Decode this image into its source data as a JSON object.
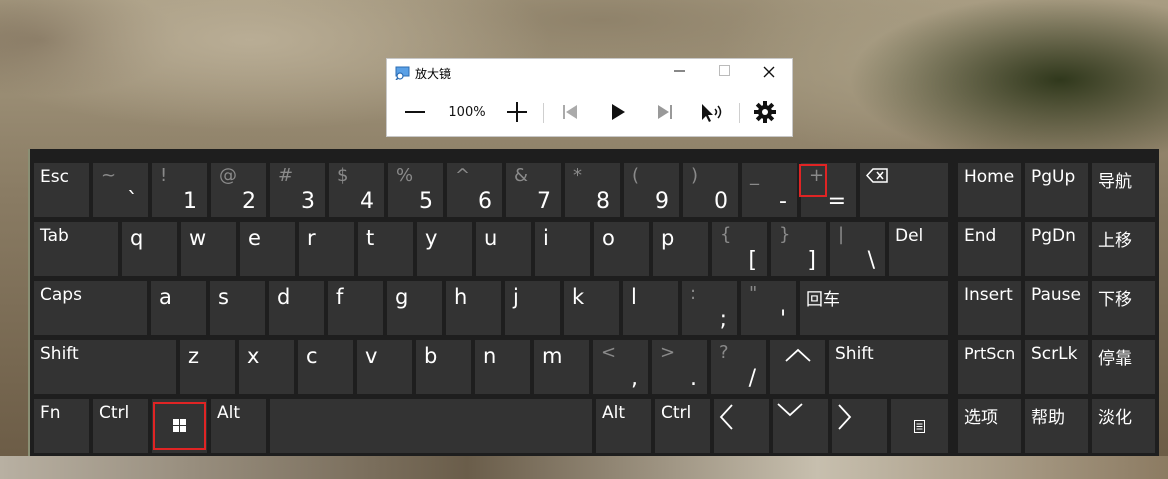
{
  "magnifier": {
    "title": "放大镜",
    "zoom_level": "100%",
    "min_icon": "minimize-icon",
    "max_icon": "maximize-icon",
    "close_icon": "close-icon"
  },
  "keyboard": {
    "row1": {
      "esc": "Esc",
      "tilde_top": "~",
      "tilde_bot": "`",
      "k1_top": "!",
      "k1_bot": "1",
      "k2_top": "@",
      "k2_bot": "2",
      "k3_top": "#",
      "k3_bot": "3",
      "k4_top": "$",
      "k4_bot": "4",
      "k5_top": "%",
      "k5_bot": "5",
      "k6_top": "^",
      "k6_bot": "6",
      "k7_top": "&",
      "k7_bot": "7",
      "k8_top": "*",
      "k8_bot": "8",
      "k9_top": "(",
      "k9_bot": "9",
      "k0_top": ")",
      "k0_bot": "0",
      "minus_top": "_",
      "minus_bot": "-",
      "equal_top": "+",
      "equal_bot": "=",
      "backspace": "⌫"
    },
    "row2": {
      "tab": "Tab",
      "letters": [
        "q",
        "w",
        "e",
        "r",
        "t",
        "y",
        "u",
        "i",
        "o",
        "p"
      ],
      "lbr_top": "{",
      "lbr_bot": "[",
      "rbr_top": "}",
      "rbr_bot": "]",
      "bs_top": "|",
      "bs_bot": "\\",
      "del": "Del"
    },
    "row3": {
      "caps": "Caps",
      "letters": [
        "a",
        "s",
        "d",
        "f",
        "g",
        "h",
        "j",
        "k",
        "l"
      ],
      "semi_top": ":",
      "semi_bot": ";",
      "quote_top": "\"",
      "quote_bot": "'",
      "enter": "回车"
    },
    "row4": {
      "shift_l": "Shift",
      "letters": [
        "z",
        "x",
        "c",
        "v",
        "b",
        "n",
        "m"
      ],
      "comma_top": "<",
      "comma_bot": ",",
      "period_top": ">",
      "period_bot": ".",
      "slash_top": "?",
      "slash_bot": "/",
      "shift_r": "Shift"
    },
    "row5": {
      "fn": "Fn",
      "ctrl_l": "Ctrl",
      "alt_l": "Alt",
      "alt_r": "Alt",
      "ctrl_r": "Ctrl"
    },
    "nav": {
      "home": "Home",
      "pgup": "PgUp",
      "nav": "导航",
      "end": "End",
      "pgdn": "PgDn",
      "moveup": "上移",
      "insert": "Insert",
      "pause": "Pause",
      "movedown": "下移",
      "prtscn": "PrtScn",
      "scrlk": "ScrLk",
      "dock": "停靠",
      "options": "选项",
      "help": "帮助",
      "fade": "淡化"
    }
  }
}
